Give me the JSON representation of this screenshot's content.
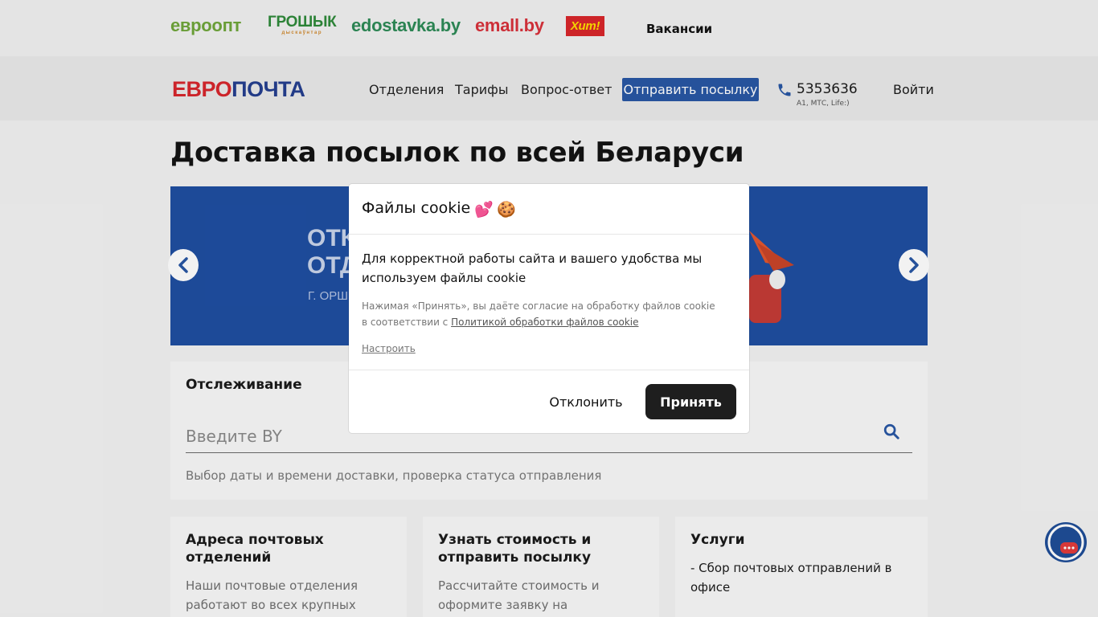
{
  "partners": {
    "evroopt": "евроопт",
    "groshyk": "ГРОШЫК",
    "groshyk_sub": "дыскаўнтар",
    "edostavka": "edostavka.by",
    "emall": "emall.by",
    "hit": "Хит!",
    "vacancies": "Вакансии"
  },
  "header": {
    "logo_part1": "ЕВРО",
    "logo_part2": "ПОЧТА",
    "nav": [
      "Отделения",
      "Тарифы",
      "Вопрос-ответ"
    ],
    "send_button": "Отправить посылку",
    "phone": "5353636",
    "phone_sub": "A1, МТС, Life:)",
    "login": "Войти"
  },
  "main": {
    "title": "Доставка посылок по всей Беларуси",
    "banner_line1": "ОТК",
    "banner_line2": "ОТД",
    "banner_sub": "Г. ОРШ"
  },
  "tracking": {
    "title": "Отслеживание",
    "placeholder": "Введите BY",
    "hint": "Выбор даты и времени доставки, проверка статуса отправления"
  },
  "cards": [
    {
      "title": "Адреса почтовых отделений",
      "text": "Наши почтовые отделения работают во всех крупных"
    },
    {
      "title": "Узнать стоимость и отправить посылку",
      "text": "Рассчитайте стоимость и оформите заявку на"
    },
    {
      "title": "Услуги",
      "text": "- Сбор почтовых отправлений в офисе"
    }
  ],
  "cookie_modal": {
    "title": "Файлы cookie",
    "emoji1": "💕",
    "emoji2": "🍪",
    "main_text": "Для корректной работы сайта и вашего удобства мы используем файлы cookie",
    "note_text": "Нажимая «Принять», вы даёте согласие на обработку файлов cookie в соответствии с ",
    "policy_link": "Политикой обработки файлов cookie",
    "setup_link": "Настроить",
    "decline_button": "Отклонить",
    "accept_button": "Принять"
  },
  "colors": {
    "brand_red": "#d7262d",
    "brand_blue": "#243f8f",
    "button_blue": "#2957a4",
    "banner_blue": "#1f4ea1",
    "accept_dark": "#1e1e1e"
  },
  "icons": [
    "phone-icon",
    "arrow-left-icon",
    "arrow-right-icon",
    "search-icon",
    "chat-icon"
  ]
}
